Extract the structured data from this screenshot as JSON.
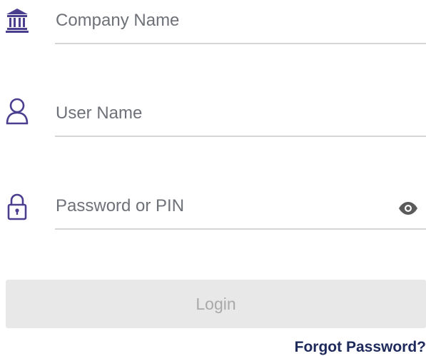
{
  "form": {
    "company": {
      "value": "",
      "placeholder": "Company Name",
      "icon": "bank-icon"
    },
    "username": {
      "value": "",
      "placeholder": "User Name",
      "icon": "user-icon"
    },
    "password": {
      "value": "",
      "placeholder": "Password or PIN",
      "icon": "lock-icon",
      "toggle_icon": "eye-icon"
    },
    "login_label": "Login",
    "login_enabled": false,
    "forgot_label": "Forgot Password?"
  },
  "colors": {
    "icon": "#4a3f8f",
    "placeholder": "#6e7178",
    "underline": "#d6d6d6",
    "button_bg": "#e8e8e8",
    "button_text": "#a9a9a9",
    "link": "#1e2a5c",
    "eye": "#5a5a5a"
  }
}
